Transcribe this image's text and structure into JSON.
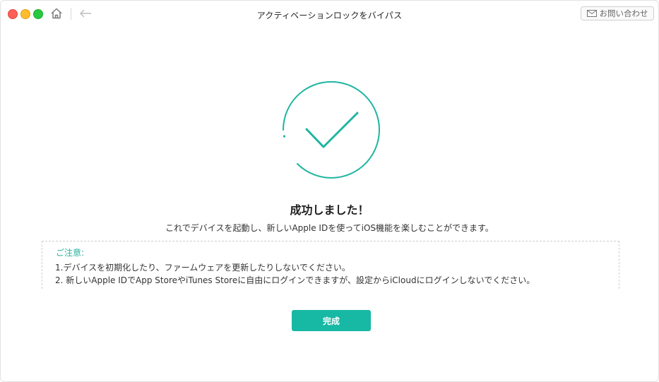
{
  "window": {
    "title": "アクティベーションロックをバイパス",
    "contact_label": "お問い合わせ"
  },
  "icons": {
    "home": "home-icon",
    "back": "back-arrow-icon",
    "mail": "mail-icon",
    "success": "checkmark-circle-icon"
  },
  "result": {
    "heading": "成功しました！",
    "message": "これでデバイスを起動し、新しいApple IDを使ってiOS機能を楽しむことができます。"
  },
  "notice": {
    "title": "ご注意:",
    "items": [
      "1.デバイスを初期化したり、ファームウェアを更新したりしないでください。",
      "2. 新しいApple IDでApp StoreやiTunes Storeに自由にログインできますが、設定からiCloudにログインしないでください。"
    ]
  },
  "actions": {
    "done_label": "完成"
  },
  "colors": {
    "accent": "#17b8a4",
    "notice_title": "#2bb19c",
    "close": "#fe5f57",
    "minimize": "#febc2e",
    "maximize": "#28c840"
  }
}
